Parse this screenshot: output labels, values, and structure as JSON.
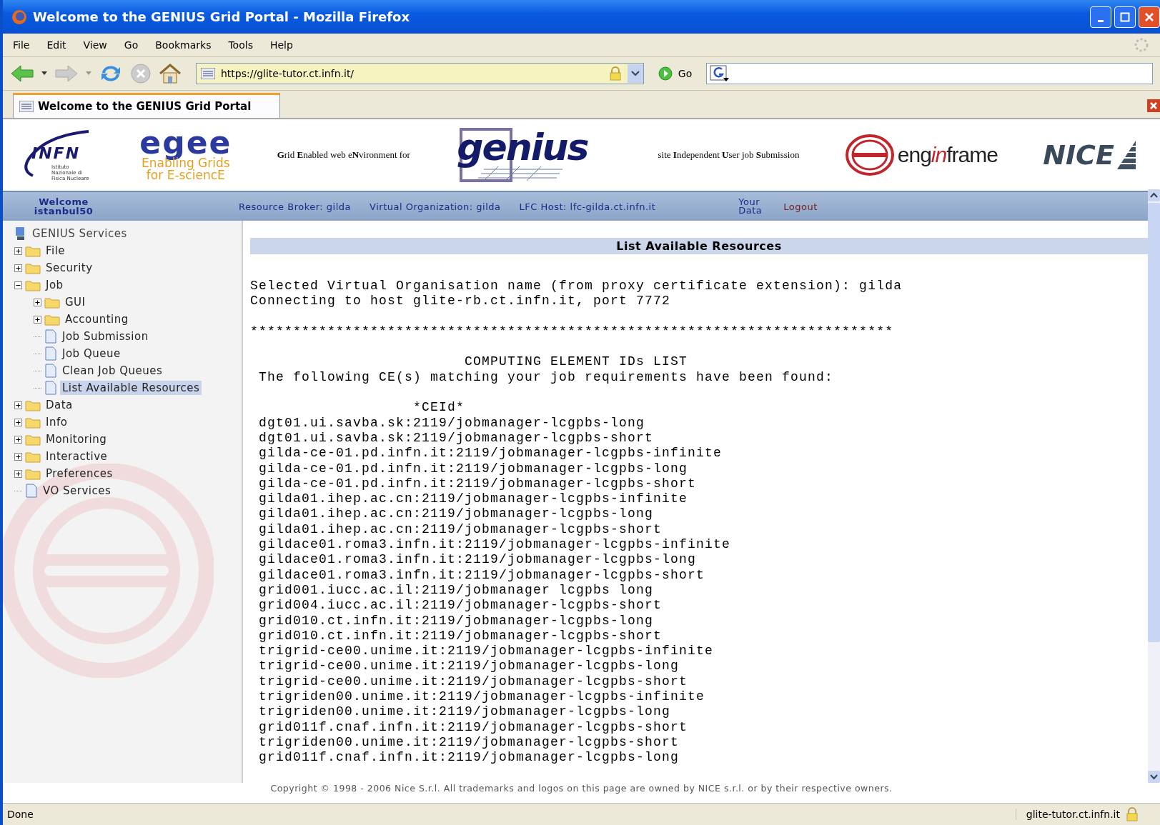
{
  "window": {
    "title": "Welcome to the GENIUS Grid Portal - Mozilla Firefox"
  },
  "menu": [
    "File",
    "Edit",
    "View",
    "Go",
    "Bookmarks",
    "Tools",
    "Help"
  ],
  "toolbar": {
    "address": "https://glite-tutor.ct.infn.it/",
    "go_label": "Go"
  },
  "tabs": [
    {
      "label": "Welcome to the GENIUS Grid Portal",
      "selected": true
    }
  ],
  "banner": {
    "infn": "INFN",
    "infn_sub": "Istituto Nazionale di Fisica Nucleare",
    "egee": "egee",
    "egee_sub1": "Enabling Grids",
    "egee_sub2": "for E-sciencE",
    "genius_tagline": "**G**rid **E**nabled web e**N**vironment for",
    "genius": "genius",
    "genius_tagline2": "site **I**ndependent **U**ser job **S**ubmission",
    "enginframe": [
      "eng",
      "in",
      "frame"
    ],
    "nice": "NICE"
  },
  "userbar": {
    "welcome": "Welcome",
    "user": "istanbul50",
    "items": [
      "Resource Broker: gilda",
      "Virtual Organization: gilda",
      "LFC Host: lfc-gilda.ct.infn.it"
    ],
    "your_data": [
      "Your",
      "Data"
    ],
    "logout": "Logout"
  },
  "sidebar": {
    "root": "GENIUS Services",
    "items": [
      {
        "label": "File",
        "kind": "folder",
        "expanded": false,
        "selected": false
      },
      {
        "label": "Security",
        "kind": "folder",
        "expanded": false,
        "selected": false
      },
      {
        "label": "Job",
        "kind": "folder",
        "expanded": true,
        "selected": false,
        "children": [
          {
            "label": "GUI",
            "kind": "folder",
            "expanded": false,
            "selected": false
          },
          {
            "label": "Accounting",
            "kind": "folder",
            "expanded": false,
            "selected": false
          },
          {
            "label": "Job Submission",
            "kind": "page",
            "selected": false
          },
          {
            "label": "Job Queue",
            "kind": "page",
            "selected": false
          },
          {
            "label": "Clean Job Queues",
            "kind": "page",
            "selected": false
          },
          {
            "label": "List Available Resources",
            "kind": "page",
            "selected": true
          }
        ]
      },
      {
        "label": "Data",
        "kind": "folder",
        "expanded": false,
        "selected": false
      },
      {
        "label": "Info",
        "kind": "folder",
        "expanded": false,
        "selected": false
      },
      {
        "label": "Monitoring",
        "kind": "folder",
        "expanded": false,
        "selected": false
      },
      {
        "label": "Interactive",
        "kind": "folder",
        "expanded": false,
        "selected": false
      },
      {
        "label": "Preferences",
        "kind": "folder",
        "expanded": false,
        "selected": false
      },
      {
        "label": "VO Services",
        "kind": "page",
        "selected": false
      }
    ]
  },
  "content": {
    "heading": "List Available Resources",
    "output": [
      "Selected Virtual Organisation name (from proxy certificate extension): gilda",
      "Connecting to host glite-rb.ct.infn.it, port 7772",
      "***************************************************************************",
      "                         COMPUTING ELEMENT IDs LIST",
      " The following CE(s) matching your job requirements have been found:",
      "                   *CEId*",
      " dgt01.ui.savba.sk:2119/jobmanager-lcgpbs-long",
      " dgt01.ui.savba.sk:2119/jobmanager-lcgpbs-short",
      " gilda-ce-01.pd.infn.it:2119/jobmanager-lcgpbs-infinite",
      " gilda-ce-01.pd.infn.it:2119/jobmanager-lcgpbs-long",
      " gilda-ce-01.pd.infn.it:2119/jobmanager-lcgpbs-short",
      " gilda01.ihep.ac.cn:2119/jobmanager-lcgpbs-infinite",
      " gilda01.ihep.ac.cn:2119/jobmanager-lcgpbs-long",
      " gilda01.ihep.ac.cn:2119/jobmanager-lcgpbs-short",
      " gildace01.roma3.infn.it:2119/jobmanager-lcgpbs-infinite",
      " gildace01.roma3.infn.it:2119/jobmanager-lcgpbs-long",
      " gildace01.roma3.infn.it:2119/jobmanager-lcgpbs-short",
      " grid001.iucc.ac.il:2119/jobmanager lcgpbs long",
      " grid004.iucc.ac.il:2119/jobmanager-lcgpbs-short",
      " grid010.ct.infn.it:2119/jobmanager-lcgpbs-long",
      " grid010.ct.infn.it:2119/jobmanager-lcgpbs-short",
      " trigrid-ce00.unime.it:2119/jobmanager-lcgpbs-infinite",
      " trigrid-ce00.unime.it:2119/jobmanager-lcgpbs-long",
      " trigrid-ce00.unime.it:2119/jobmanager-lcgpbs-short",
      " trigriden00.unime.it:2119/jobmanager-lcgpbs-infinite",
      " trigriden00.unime.it:2119/jobmanager-lcgpbs-long",
      " grid011f.cnaf.infn.it:2119/jobmanager-lcgpbs-short",
      " trigriden00.unime.it:2119/jobmanager-lcgpbs-short",
      " grid011f.cnaf.infn.it:2119/jobmanager-lcgpbs-long"
    ],
    "copyright": "Copyright © 1998 - 2006 Nice S.r.l. All trademarks and logos on this page are owned by NICE s.r.l. or by their respective owners."
  },
  "status_bar": {
    "text": "Done",
    "host": "glite-tutor.ct.infn.it"
  }
}
